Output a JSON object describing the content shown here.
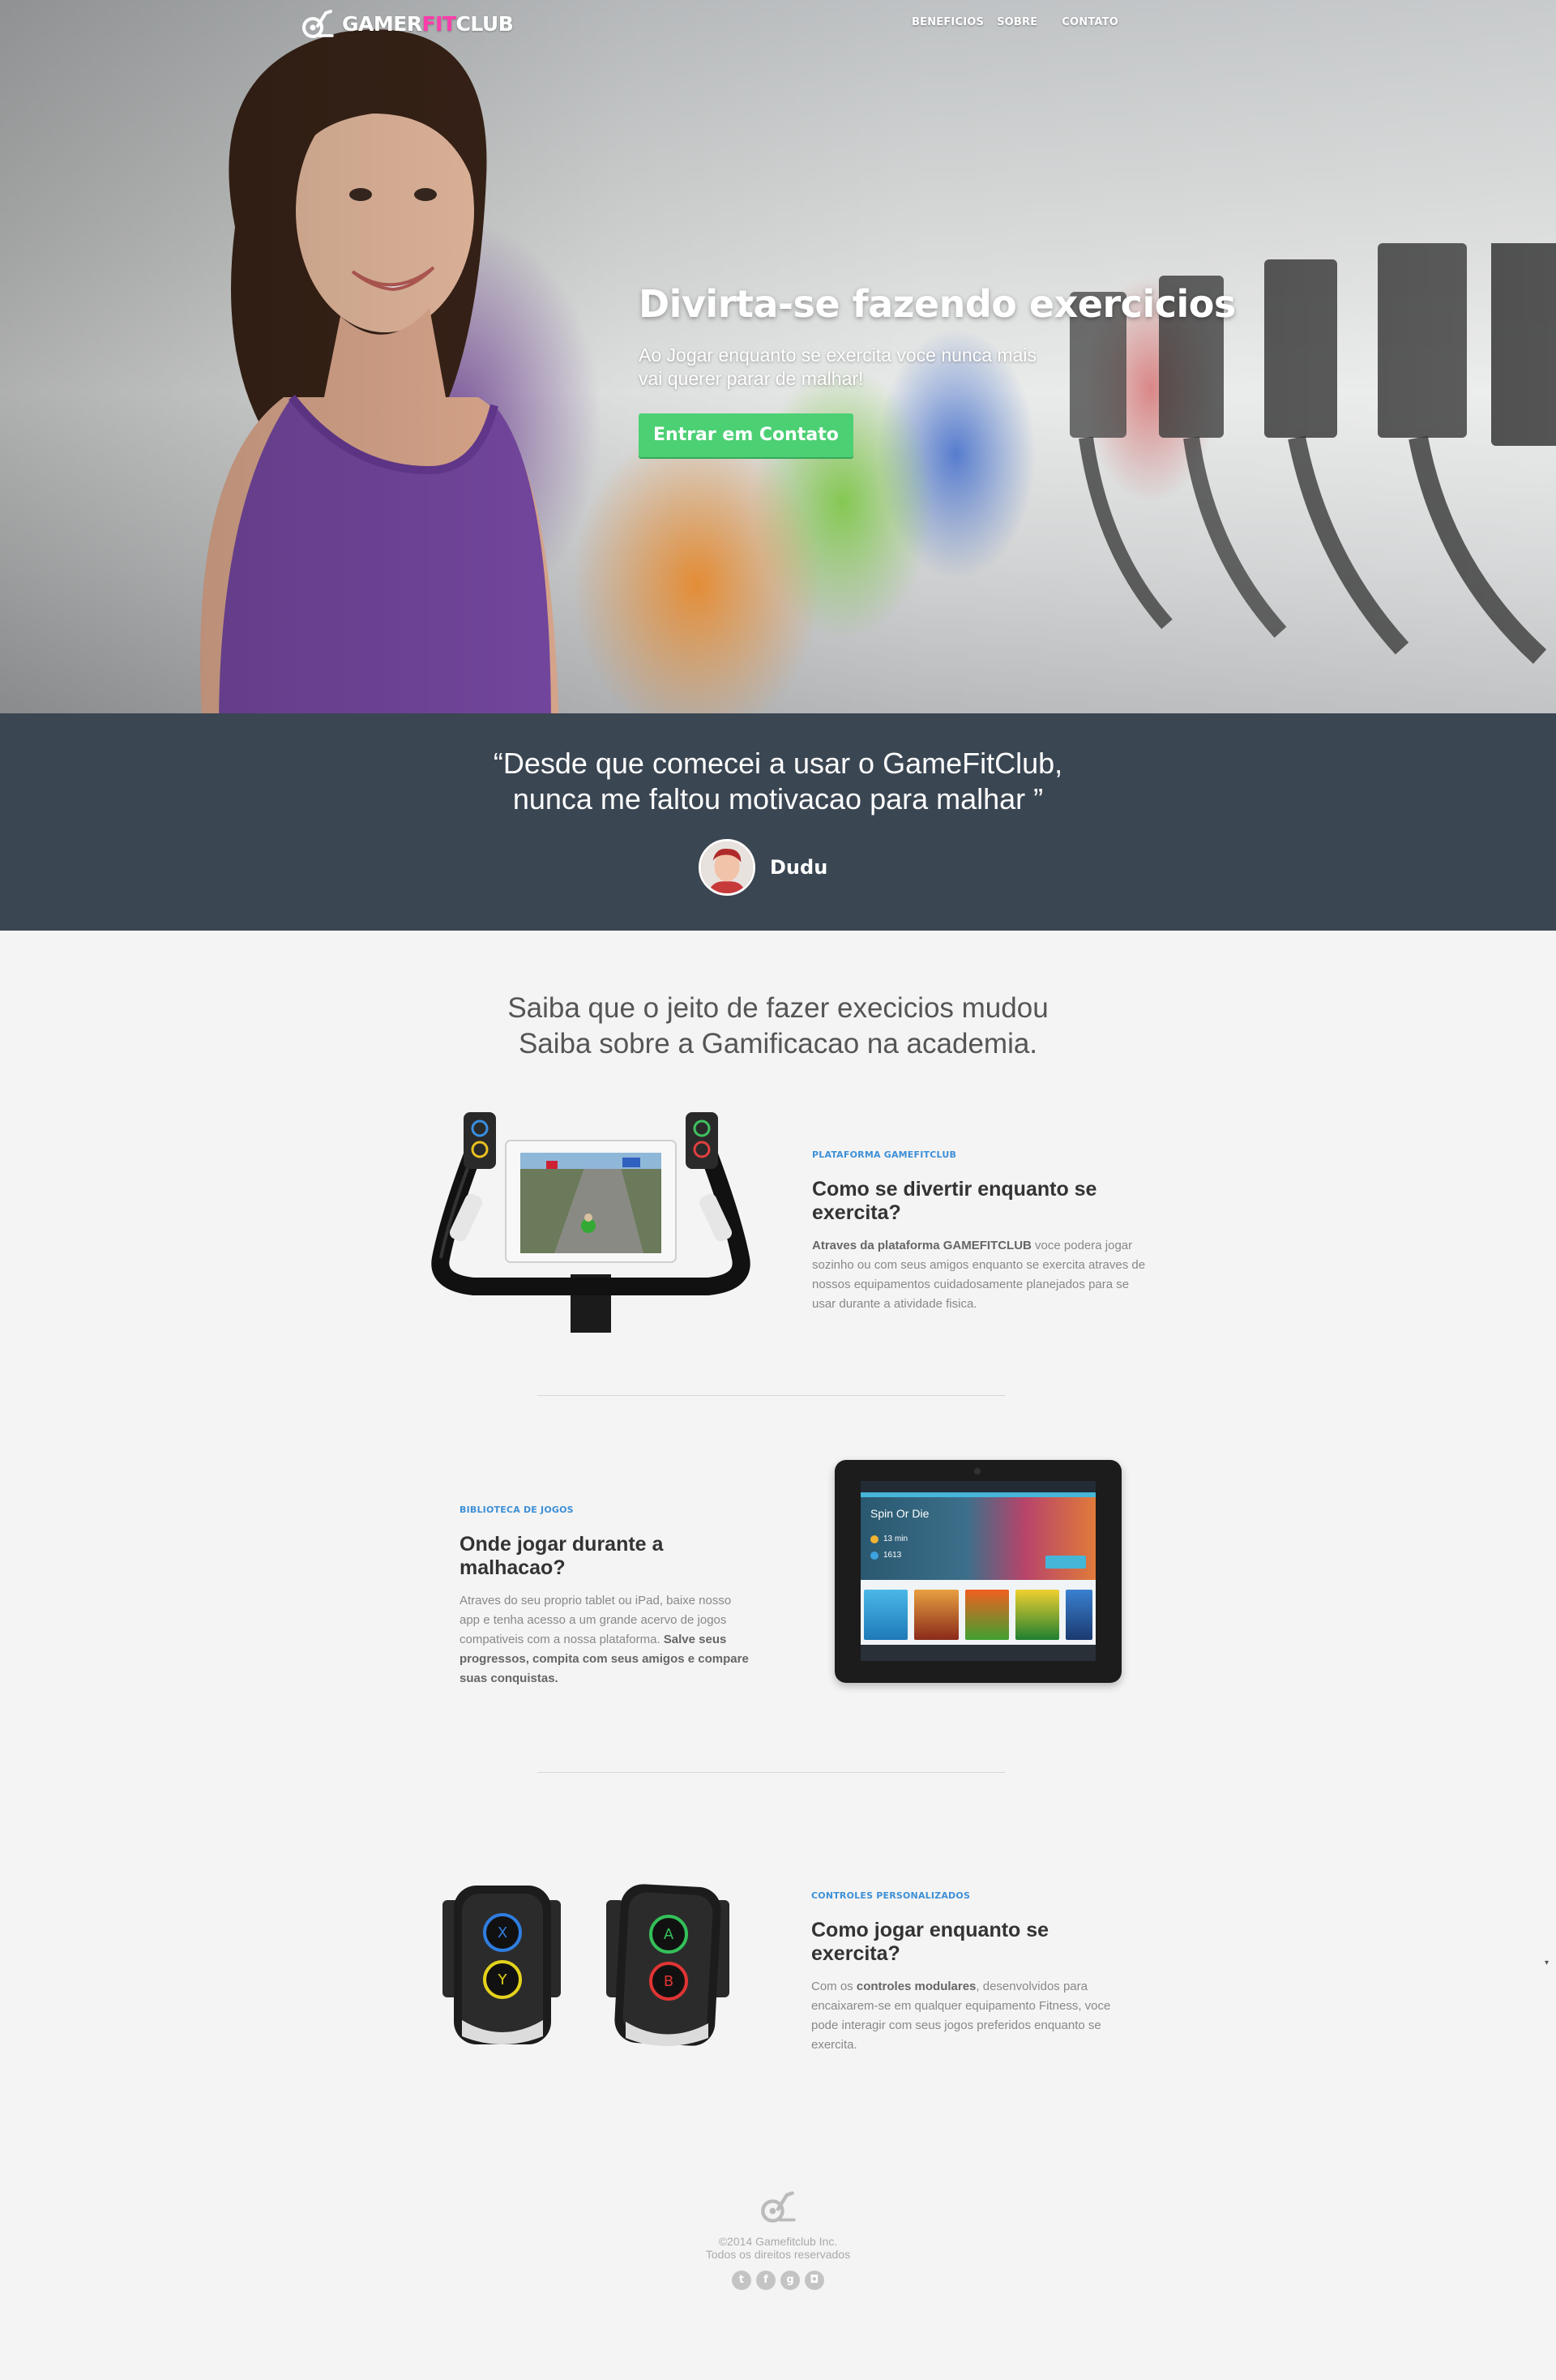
{
  "brand": {
    "name_part1": "GAMER",
    "name_part2": "FIT",
    "name_part3": "CLUB",
    "accent_color": "#ff3cac"
  },
  "nav": {
    "items": [
      {
        "label": "BENEFICIOS"
      },
      {
        "label": "SOBRE"
      },
      {
        "label": "CONTATO"
      }
    ]
  },
  "hero": {
    "title": "Divirta-se fazendo exercicios",
    "subtitle": "Ao Jogar enquanto se exercita voce nunca mais vai querer parar de malhar!",
    "cta_label": "Entrar em Contato",
    "cta_color": "#4cd074"
  },
  "testimonial": {
    "quote_line1": "“Desde que comecei a usar o GameFitClub,",
    "quote_line2": "nunca me faltou motivacao para malhar ”",
    "author": "Dudu",
    "background": "#3a4652"
  },
  "intro": {
    "line1": "Saiba que o jeito de fazer execicios mudou",
    "line2": "Saiba sobre a Gamificacao na academia."
  },
  "features": [
    {
      "label": "PLATAFORMA GAMEFITCLUB",
      "title": "Como se divertir enquanto se exercita?",
      "text_bold": "Atraves da plataforma GAMEFITCLUB",
      "text_rest": " voce podera jogar sozinho ou com seus amigos enquanto se exercita atraves de nossos equipamentos cuidadosamente planejados para se usar durante a atividade fisica."
    },
    {
      "label": "BIBLIOTECA DE JOGOS",
      "title": "Onde jogar durante a malhacao?",
      "text_rest": "Atraves do seu proprio tablet ou iPad, baixe nosso app e tenha acesso a um grande acervo de jogos compativeis com a nossa plataforma. ",
      "text_bold": "Salve seus progressos, compita com seus amigos e compare suas conquistas."
    },
    {
      "label": "CONTROLES PERSONALIZADOS",
      "title": "Como jogar enquanto se exercita?",
      "text_pre": "Com os ",
      "text_bold": "controles modulares",
      "text_rest": ", desenvolvidos para encaixarem-se em qualquer equipamento Fitness, voce pode interagir com seus jogos preferidos enquanto se exercita."
    }
  ],
  "tablet_app": {
    "game_title": "Spin Or Die",
    "time": "13 min",
    "score": "1613"
  },
  "controllers": {
    "left_buttons": [
      "X",
      "Y"
    ],
    "right_buttons": [
      "A",
      "B"
    ]
  },
  "footer": {
    "copyright": "©2014 Gamefitclub Inc.",
    "rights": "Todos os direitos reservados",
    "social": [
      "twitter-icon",
      "facebook-icon",
      "google-plus-icon",
      "instagram-icon"
    ]
  }
}
